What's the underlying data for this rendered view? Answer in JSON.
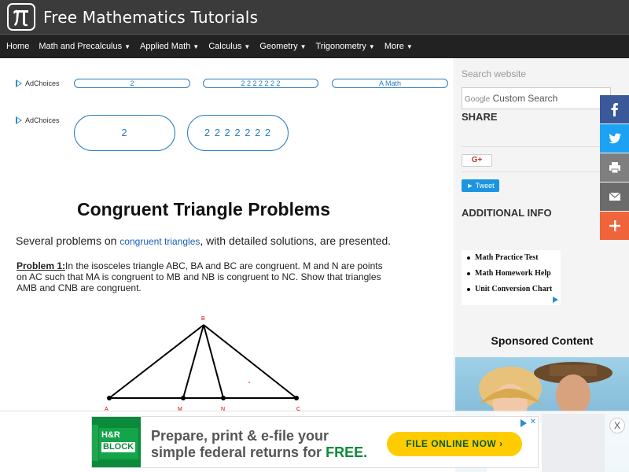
{
  "header": {
    "site_title": "Free Mathematics Tutorials",
    "logo_glyph": "π"
  },
  "nav": {
    "items": [
      {
        "label": "Home",
        "dropdown": false
      },
      {
        "label": "Math and Precalculus",
        "dropdown": true
      },
      {
        "label": "Applied Math",
        "dropdown": true
      },
      {
        "label": "Calculus",
        "dropdown": true
      },
      {
        "label": "Geometry",
        "dropdown": true
      },
      {
        "label": "Trigonometry",
        "dropdown": true
      },
      {
        "label": "More",
        "dropdown": true
      }
    ]
  },
  "ads": {
    "adchoices_label": "AdChoices",
    "row1": [
      "2",
      "2 2 2 2 2 2 2",
      "A Math"
    ],
    "row2": [
      "2",
      "2 2 2 2 2 2 2"
    ]
  },
  "article": {
    "title": "Congruent Triangle Problems",
    "intro_before": "Several problems on ",
    "intro_link": "congruent triangles",
    "intro_after": ", with detailed solutions, are presented.",
    "problem1_label": "Problem 1:",
    "problem1_text": "In the isosceles triangle ABC, BA and BC are congruent. M and N are points on AC such that MA is congruent to MB and NB is congruent to NC. Show that triangles AMB and CNB are congruent.",
    "diagram_labels": {
      "A": "A",
      "B": "B",
      "M": "M",
      "N": "N",
      "C": "C"
    }
  },
  "sidebar": {
    "search_label": "Search website",
    "search_placeholder": "Custom Search",
    "search_google": "Google",
    "share_heading": "SHARE",
    "gplus_label": "G+",
    "tweet_label": "Tweet",
    "additional_heading": "ADDITIONAL INFO",
    "ad_links": [
      "Math Practice Test",
      "Math Homework Help",
      "Unit Conversion Chart"
    ],
    "sponsored_heading": "Sponsored Content"
  },
  "social": [
    {
      "name": "facebook",
      "color": "#3b5998"
    },
    {
      "name": "twitter",
      "color": "#1da1f2"
    },
    {
      "name": "print",
      "color": "#7f7f7f"
    },
    {
      "name": "email",
      "color": "#6b6b6b"
    },
    {
      "name": "more",
      "color": "#f0643c"
    }
  ],
  "bottom_ad": {
    "brand_line1": "H&R",
    "brand_line2": "BLOCK",
    "headline_line1": "Prepare, print & e-file your",
    "headline_line2_before": "simple federal returns for ",
    "headline_free": "FREE.",
    "cta": "FILE ONLINE NOW ›",
    "close_label": "X",
    "ad_x": "✕"
  }
}
